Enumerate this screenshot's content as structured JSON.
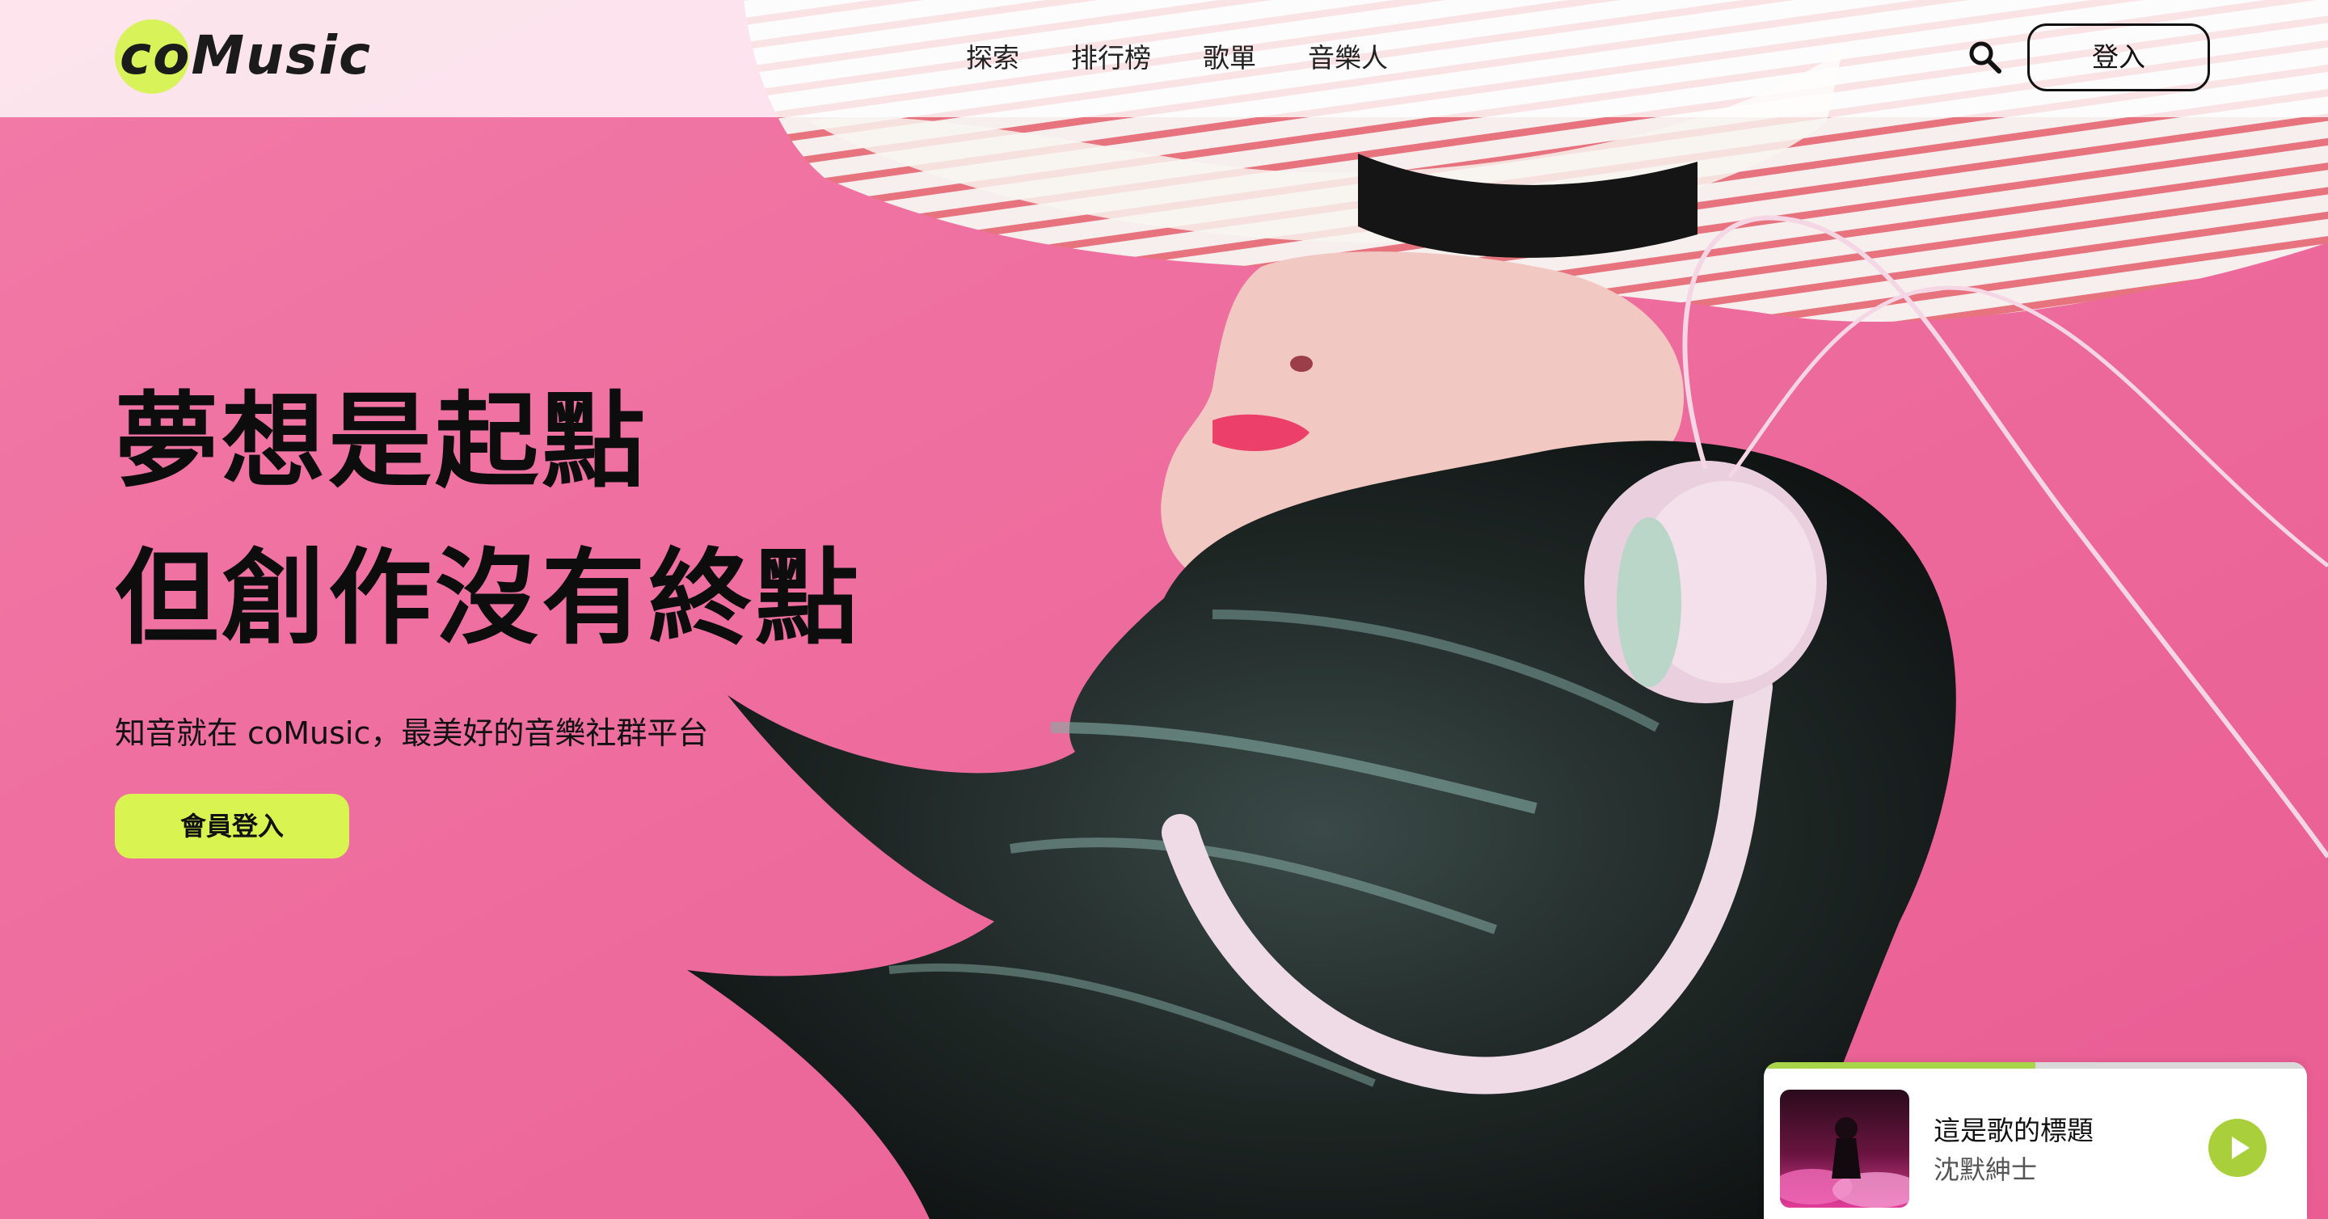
{
  "app": {
    "logo_text": "coMusic",
    "accent_color": "#d9f450",
    "background_color": "#ee6a9c"
  },
  "nav": {
    "items": [
      {
        "label": "探索"
      },
      {
        "label": "排行榜"
      },
      {
        "label": "歌單"
      },
      {
        "label": "音樂人"
      }
    ],
    "search_icon": "search-icon",
    "login_label": "登入"
  },
  "hero": {
    "headline_line1": "夢想是起點",
    "headline_line2": "但創作沒有終點",
    "subtitle": "知音就在 coMusic，最美好的音樂社群平台",
    "cta_label": "會員登入",
    "image": "girl-with-headphones-photo"
  },
  "player": {
    "song_title": "這是歌的標題",
    "artist": "沈默紳士",
    "progress": 0.5,
    "play_icon": "play-icon",
    "cover_image": "album-cover"
  }
}
